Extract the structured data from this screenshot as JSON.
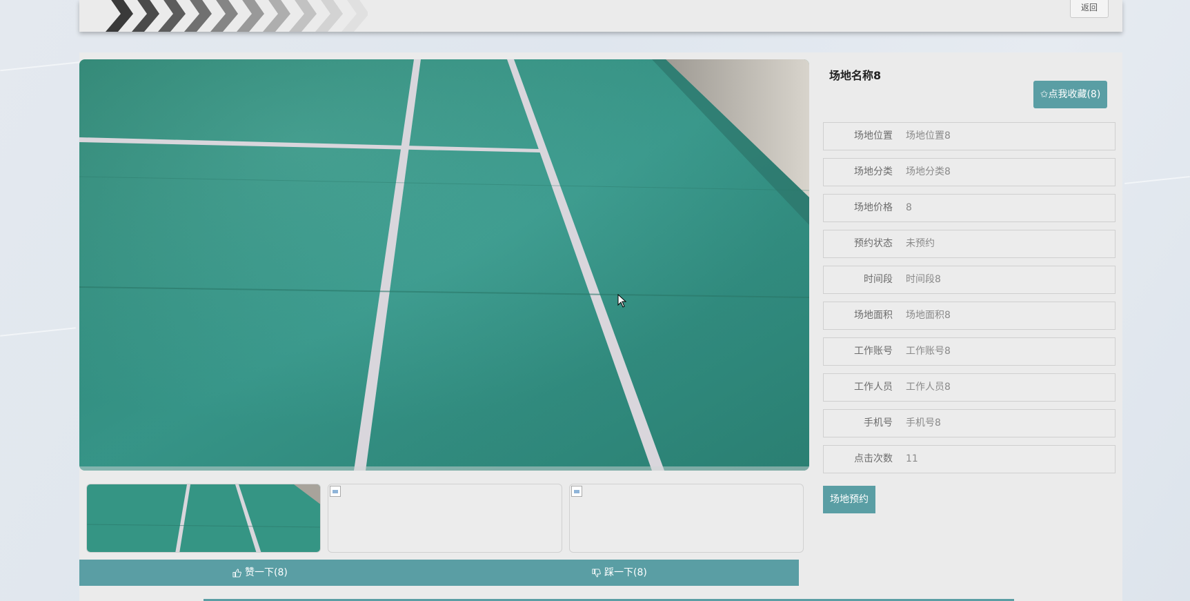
{
  "header": {
    "back_label": "返回"
  },
  "venue": {
    "title": "场地名称8",
    "favorite_label": "✩点我收藏(8)",
    "details": [
      {
        "label": "场地位置",
        "value": "场地位置8"
      },
      {
        "label": "场地分类",
        "value": "场地分类8"
      },
      {
        "label": "场地价格",
        "value": "8"
      },
      {
        "label": "预约状态",
        "value": "未预约"
      },
      {
        "label": "时间段",
        "value": "时间段8"
      },
      {
        "label": "场地面积",
        "value": "场地面积8"
      },
      {
        "label": "工作账号",
        "value": "工作账号8"
      },
      {
        "label": "工作人员",
        "value": "工作人员8"
      },
      {
        "label": "手机号",
        "value": "手机号8"
      },
      {
        "label": "点击次数",
        "value": "11"
      }
    ],
    "book_label": "场地预约"
  },
  "votes": {
    "like_label": "赞一下(8)",
    "dislike_label": "踩一下(8)"
  },
  "colors": {
    "accent": "#5a9ea4",
    "court_green": "#3f9b8c"
  },
  "icons": [
    "thumbs-up-icon",
    "thumbs-down-icon",
    "star-icon",
    "chevron-icon",
    "cursor-icon"
  ]
}
